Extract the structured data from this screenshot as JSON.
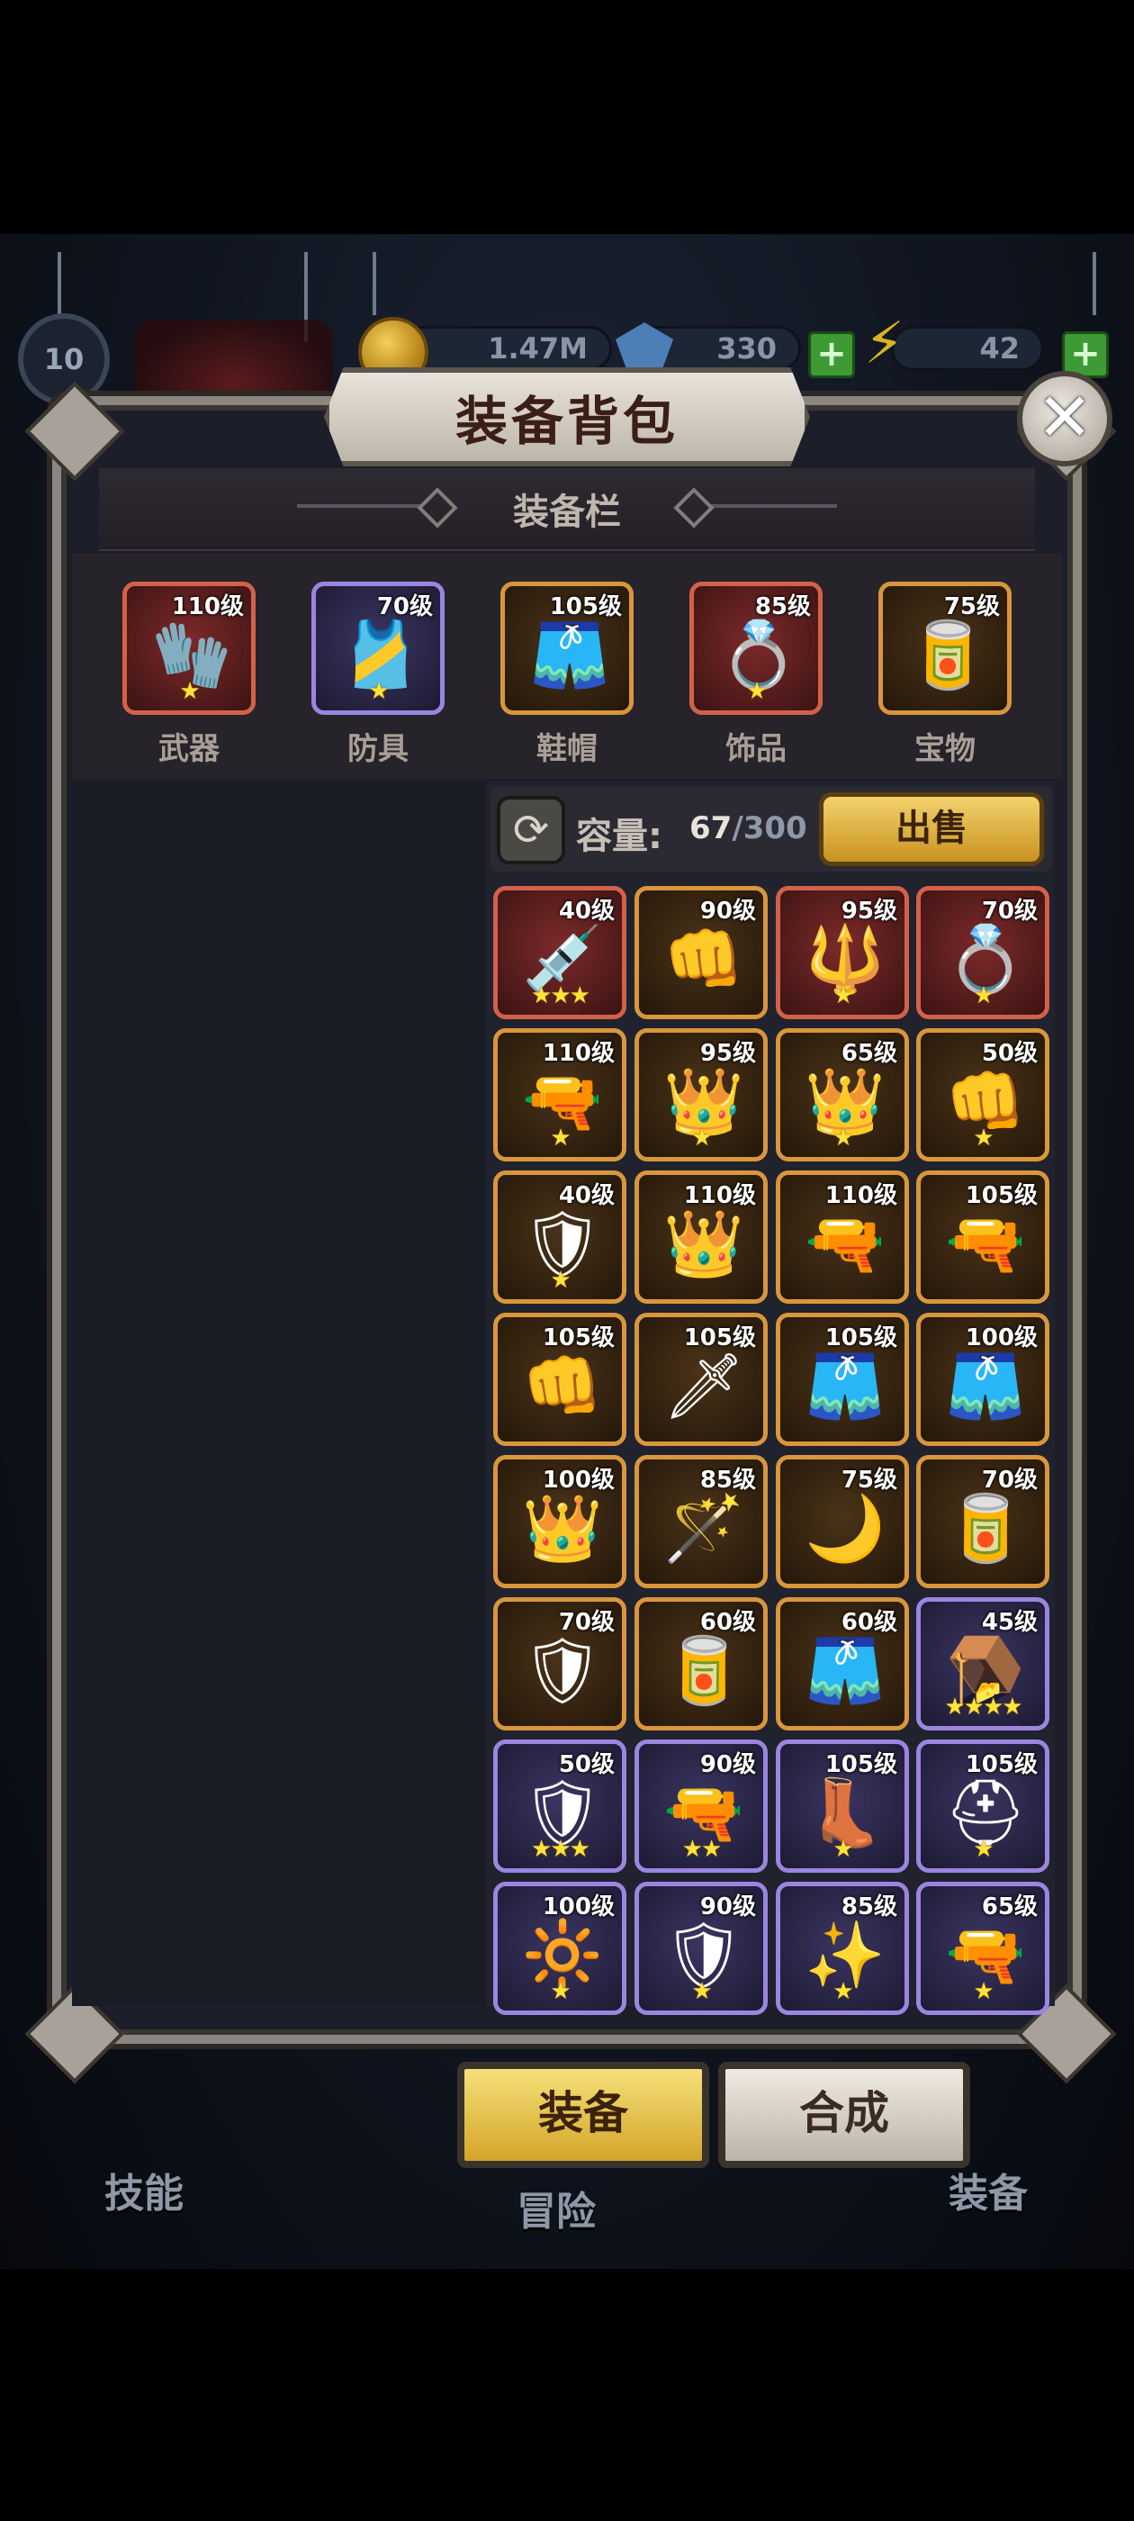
{
  "hud": {
    "level": "10",
    "gold": "1.47M",
    "gems": "330",
    "energy": "42"
  },
  "panel": {
    "title": "装备背包",
    "close_symbol": "✕",
    "section_title": "装备栏"
  },
  "equipped": [
    {
      "label": "武器",
      "level": "110级",
      "stars": "★",
      "rarity": "red",
      "icon": "gauntlet-icon",
      "glyph": "🧤"
    },
    {
      "label": "防具",
      "level": "70级",
      "stars": "★",
      "rarity": "purple",
      "icon": "vest-icon",
      "glyph": "🎽"
    },
    {
      "label": "鞋帽",
      "level": "105级",
      "stars": "",
      "rarity": "orange",
      "icon": "pants-icon",
      "glyph": "🩳"
    },
    {
      "label": "饰品",
      "level": "85级",
      "stars": "★",
      "rarity": "red",
      "icon": "ring-icon",
      "glyph": "💍"
    },
    {
      "label": "宝物",
      "level": "75级",
      "stars": "",
      "rarity": "orange",
      "icon": "scroll-icon",
      "glyph": "🥫"
    }
  ],
  "inventory": {
    "capacity_label": "容量:",
    "capacity_used": "67",
    "capacity_sep": "/300",
    "sell_label": "出售",
    "refresh_symbol": "⟳",
    "items": [
      {
        "level": "40级",
        "stars": "★★★",
        "rarity": "red",
        "icon": "syringe-icon",
        "glyph": "💉"
      },
      {
        "level": "90级",
        "stars": "",
        "rarity": "orange",
        "icon": "fist-icon",
        "glyph": "👊"
      },
      {
        "level": "95级",
        "stars": "★",
        "rarity": "red",
        "icon": "staff-icon",
        "glyph": "🔱"
      },
      {
        "level": "70级",
        "stars": "★",
        "rarity": "red",
        "icon": "ring-icon",
        "glyph": "💍"
      },
      {
        "level": "110级",
        "stars": "★",
        "rarity": "orange",
        "icon": "drill-gun-icon",
        "glyph": "🔫"
      },
      {
        "level": "95级",
        "stars": "★",
        "rarity": "orange",
        "icon": "crown-icon",
        "glyph": "👑"
      },
      {
        "level": "65级",
        "stars": "★",
        "rarity": "orange",
        "icon": "crown-icon",
        "glyph": "👑"
      },
      {
        "level": "50级",
        "stars": "★",
        "rarity": "orange",
        "icon": "fist-icon",
        "glyph": "👊"
      },
      {
        "level": "40级",
        "stars": "★",
        "rarity": "orange",
        "icon": "armor-icon",
        "glyph": "🛡"
      },
      {
        "level": "110级",
        "stars": "",
        "rarity": "orange",
        "icon": "crown-icon",
        "glyph": "👑"
      },
      {
        "level": "110级",
        "stars": "",
        "rarity": "orange",
        "icon": "drill-gun-icon",
        "glyph": "🔫"
      },
      {
        "level": "105级",
        "stars": "",
        "rarity": "orange",
        "icon": "drill-gun-icon",
        "glyph": "🔫"
      },
      {
        "level": "105级",
        "stars": "",
        "rarity": "orange",
        "icon": "fist-icon",
        "glyph": "👊"
      },
      {
        "level": "105级",
        "stars": "",
        "rarity": "orange",
        "icon": "sword-icon",
        "glyph": "🗡"
      },
      {
        "level": "105级",
        "stars": "",
        "rarity": "orange",
        "icon": "pants-icon",
        "glyph": "🩳"
      },
      {
        "level": "100级",
        "stars": "",
        "rarity": "orange",
        "icon": "pants-icon",
        "glyph": "🩳"
      },
      {
        "level": "100级",
        "stars": "",
        "rarity": "orange",
        "icon": "crown-icon",
        "glyph": "👑"
      },
      {
        "level": "85级",
        "stars": "",
        "rarity": "orange",
        "icon": "wand-icon",
        "glyph": "🪄"
      },
      {
        "level": "75级",
        "stars": "",
        "rarity": "orange",
        "icon": "claw-ring-icon",
        "glyph": "🌙"
      },
      {
        "level": "70级",
        "stars": "",
        "rarity": "orange",
        "icon": "scroll-icon",
        "glyph": "🥫"
      },
      {
        "level": "70级",
        "stars": "",
        "rarity": "orange",
        "icon": "armor-icon",
        "glyph": "🛡"
      },
      {
        "level": "60级",
        "stars": "",
        "rarity": "orange",
        "icon": "scroll-icon",
        "glyph": "🥫"
      },
      {
        "level": "60级",
        "stars": "",
        "rarity": "orange",
        "icon": "pants-icon",
        "glyph": "🩳"
      },
      {
        "level": "45级",
        "stars": "★★★★",
        "rarity": "purple",
        "icon": "mousetrap-icon",
        "glyph": "🪤"
      },
      {
        "level": "50级",
        "stars": "★★★",
        "rarity": "purple",
        "icon": "shield-icon",
        "glyph": "🛡"
      },
      {
        "level": "90级",
        "stars": "★★",
        "rarity": "purple",
        "icon": "rifle-icon",
        "glyph": "🔫"
      },
      {
        "level": "105级",
        "stars": "★",
        "rarity": "purple",
        "icon": "boots-icon",
        "glyph": "👢"
      },
      {
        "level": "105级",
        "stars": "★",
        "rarity": "purple",
        "icon": "helmet-icon",
        "glyph": "⛑"
      },
      {
        "level": "100级",
        "stars": "★",
        "rarity": "purple",
        "icon": "amulet-icon",
        "glyph": "🔆"
      },
      {
        "level": "90级",
        "stars": "★",
        "rarity": "purple",
        "icon": "shield-icon",
        "glyph": "🛡"
      },
      {
        "level": "85级",
        "stars": "★",
        "rarity": "purple",
        "icon": "torch-staff-icon",
        "glyph": "✨"
      },
      {
        "level": "65级",
        "stars": "★",
        "rarity": "purple",
        "icon": "tommy-gun-icon",
        "glyph": "🔫"
      }
    ]
  },
  "tabs": {
    "equip": "装备",
    "craft": "合成"
  },
  "bottom_nav": {
    "skills": "技能",
    "adventure": "冒险",
    "gear": "装备"
  }
}
